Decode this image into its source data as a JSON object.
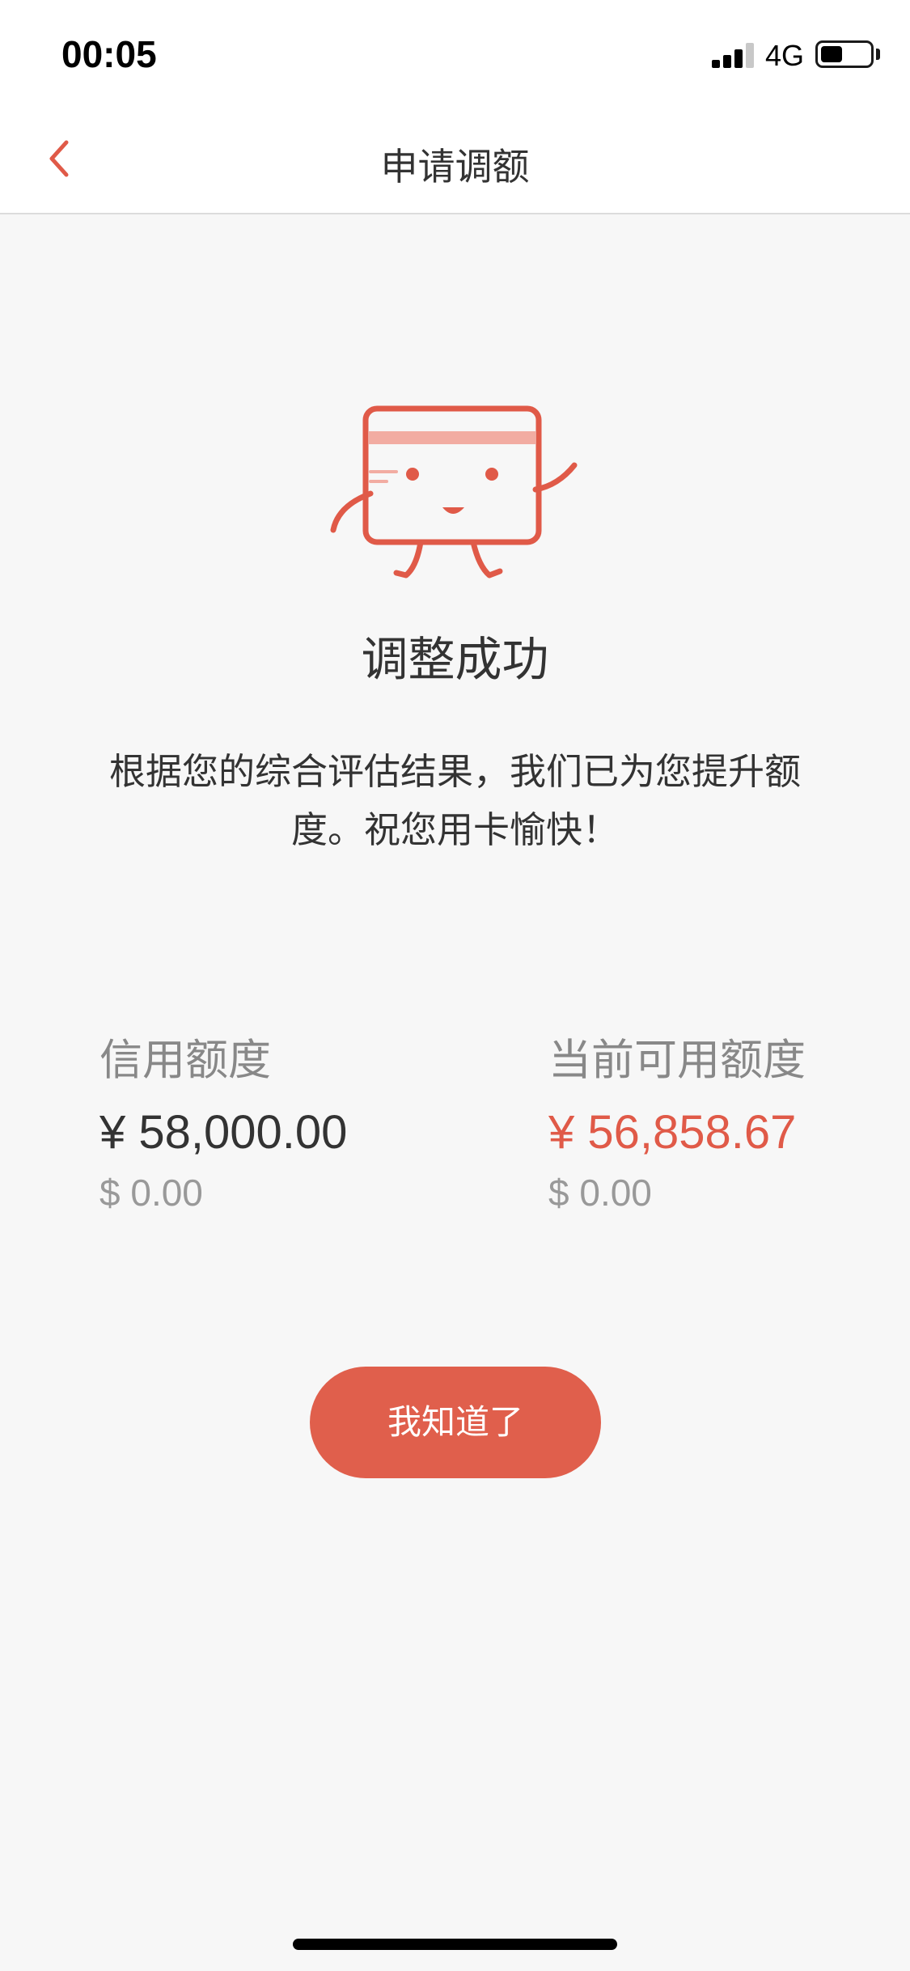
{
  "status_bar": {
    "time": "00:05",
    "network": "4G",
    "signal_icon": "cellular-signal-icon",
    "battery_icon": "battery-icon"
  },
  "nav": {
    "title": "申请调额",
    "back_icon": "chevron-left-icon"
  },
  "result": {
    "illustration": "card-mascot-waving-icon",
    "title": "调整成功",
    "message": "根据您的综合评估结果，我们已为您提升额度。祝您用卡愉快！"
  },
  "credit_limit": {
    "label": "信用额度",
    "cny": "¥ 58,000.00",
    "usd": "$ 0.00"
  },
  "available_limit": {
    "label": "当前可用额度",
    "cny": "¥ 56,858.67",
    "usd": "$ 0.00"
  },
  "actions": {
    "confirm_label": "我知道了"
  },
  "colors": {
    "accent": "#e05a48",
    "background": "#f7f7f7"
  }
}
